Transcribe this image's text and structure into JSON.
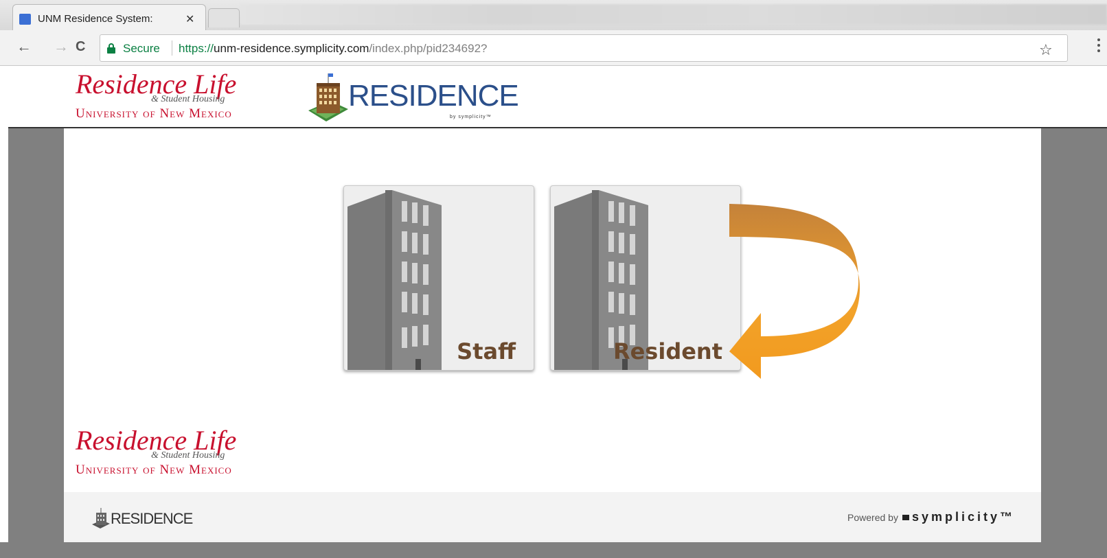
{
  "browser": {
    "tab_title": "UNM Residence System:",
    "tab_close": "✕",
    "nav": {
      "back": "←",
      "forward": "→",
      "reload": "C"
    },
    "secure_label": "Secure",
    "url_scheme": "https://",
    "url_host": "unm-residence.symplicity.com",
    "url_path": "/index.php/pid234692?",
    "bookmark_icon": "☆"
  },
  "header": {
    "logo_script": "Residence Life",
    "logo_sub": "& Student Housing",
    "logo_university": "University of New Mexico",
    "app_logo_text": "RESIDENCE",
    "app_logo_by": "by symplicity™"
  },
  "portals": [
    {
      "label": "Staff"
    },
    {
      "label": "Resident"
    }
  ],
  "footer": {
    "logo_script": "Residence Life",
    "logo_sub": "& Student Housing",
    "logo_university": "University of New Mexico",
    "app_logo_text": "RESIDENCE",
    "powered_by": "Powered by",
    "powered_brand": "symplicity™"
  },
  "colors": {
    "brand_red": "#c8102e",
    "residence_blue": "#2b4f8a",
    "label_brown": "#6b4a2e",
    "arrow_orange": "#f2a22a",
    "gutter_gray": "#808080"
  }
}
